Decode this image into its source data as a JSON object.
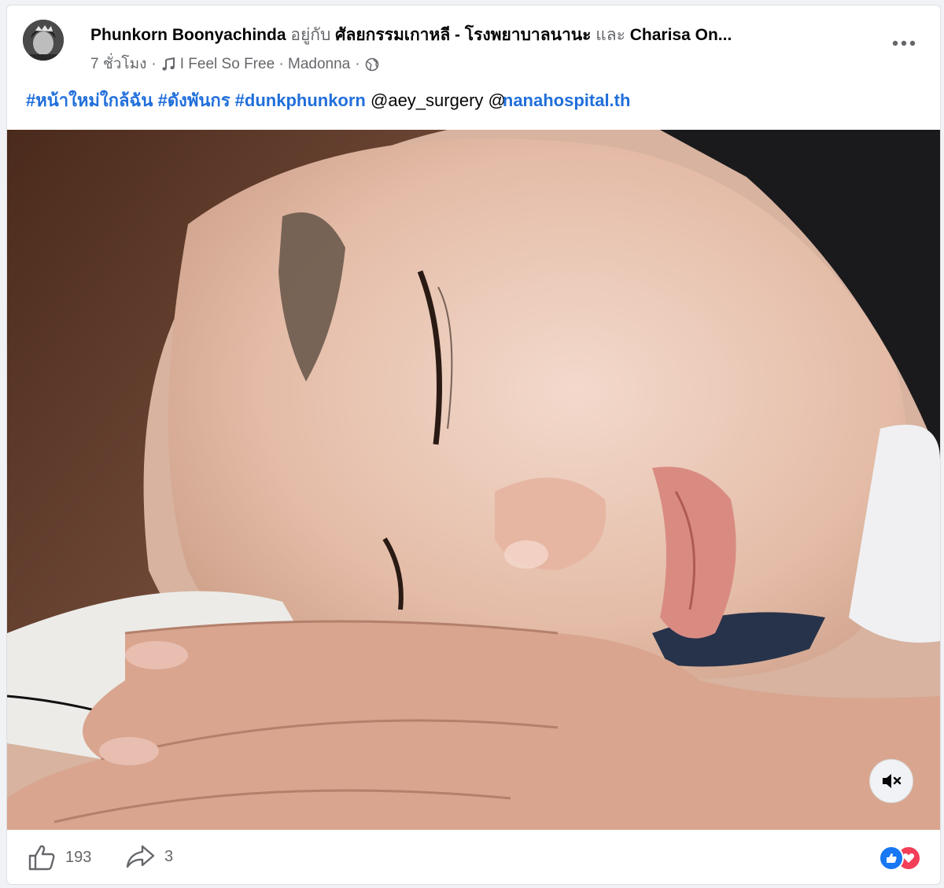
{
  "post": {
    "author": "Phunkorn Boonyachinda",
    "with_word": "อยู่กับ",
    "tagged_page": "ศัลยกรรมเกาหลี - โรงพยาบาลนานะ",
    "and_word": "และ",
    "tagged_person": "Charisa On...",
    "time": "7 ชั่วโมง",
    "music": "I Feel So Free · Madonna",
    "separator": "·",
    "caption": {
      "tag1": "#หน้าใหม่ใกล้ฉัน",
      "tag2": "#ดังพันกร",
      "tag3": "#dunkphunkorn",
      "mention1": "@aey_surgery",
      "mention2_prefix": "@",
      "mention2": "nanahospital.th"
    }
  },
  "footer": {
    "like_count": "193",
    "share_count": "3"
  },
  "icons": {
    "more": "more-horizontal-icon",
    "globe": "globe-icon",
    "music": "music-note-icon",
    "mute": "speaker-muted-icon",
    "like": "thumbs-up-icon",
    "share": "share-arrow-icon"
  },
  "colors": {
    "link": "#216fdb",
    "like": "#1877f2",
    "love": "#f33e58",
    "muted_text": "#65676b"
  }
}
